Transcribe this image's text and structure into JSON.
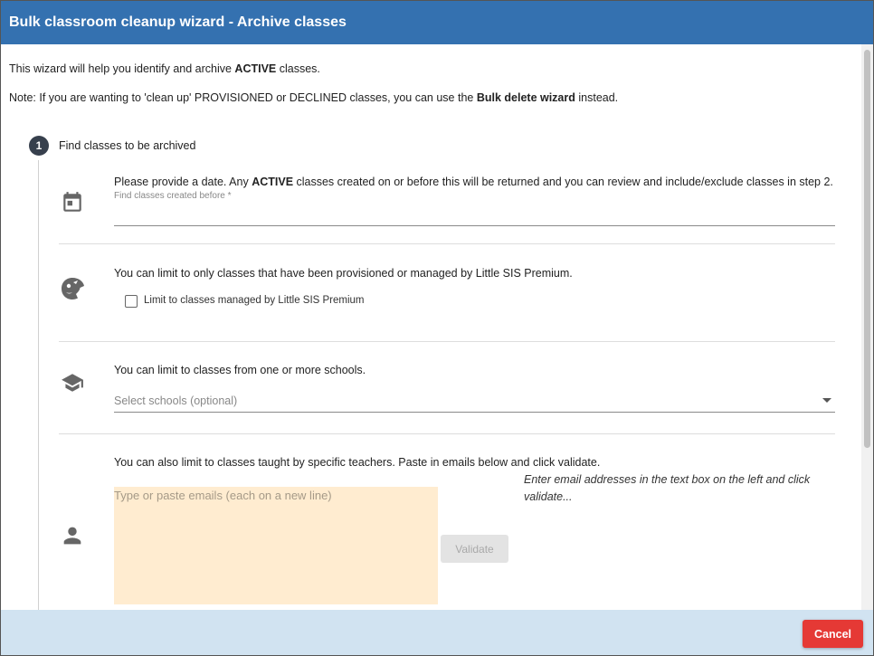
{
  "dialog": {
    "title": "Bulk classroom cleanup wizard - Archive classes"
  },
  "intro": {
    "line1_pre": "This wizard will help you identify and archive ",
    "line1_bold": "ACTIVE",
    "line1_post": " classes.",
    "line2_pre": "Note: If you are wanting to 'clean up' PROVISIONED or DECLINED classes, you can use the ",
    "line2_bold": "Bulk delete wizard",
    "line2_post": " instead."
  },
  "step": {
    "number": "1",
    "label": "Find classes to be archived"
  },
  "date_section": {
    "icon": "calendar-icon",
    "text_pre": "Please provide a date. Any ",
    "text_bold": "ACTIVE",
    "text_post": " classes created on or before this will be returned and you can review and include/exclude classes in step 2.",
    "field_label": "Find classes created before *",
    "value": ""
  },
  "premium_section": {
    "icon": "little-sis-logo-icon",
    "text": "You can limit to only classes that have been provisioned or managed by Little SIS Premium.",
    "checkbox_label": "Limit to classes managed by Little SIS Premium",
    "checked": false
  },
  "schools_section": {
    "icon": "school-icon",
    "text": "You can limit to classes from one or more schools.",
    "select_placeholder": "Select schools (optional)"
  },
  "teachers_section": {
    "icon": "person-icon",
    "text": "You can also limit to classes taught by specific teachers. Paste in emails below and click validate.",
    "textarea_placeholder": "Type or paste emails (each on a new line)",
    "validate_label": "Validate",
    "hint": "Enter email addresses in the text box on the left and click validate..."
  },
  "footer": {
    "cancel_label": "Cancel"
  },
  "colors": {
    "titlebar": "#3471b0",
    "footer": "#d1e3f1",
    "cancel": "#e53935",
    "email_box": "#ffecd0",
    "step_circle": "#37404d"
  }
}
